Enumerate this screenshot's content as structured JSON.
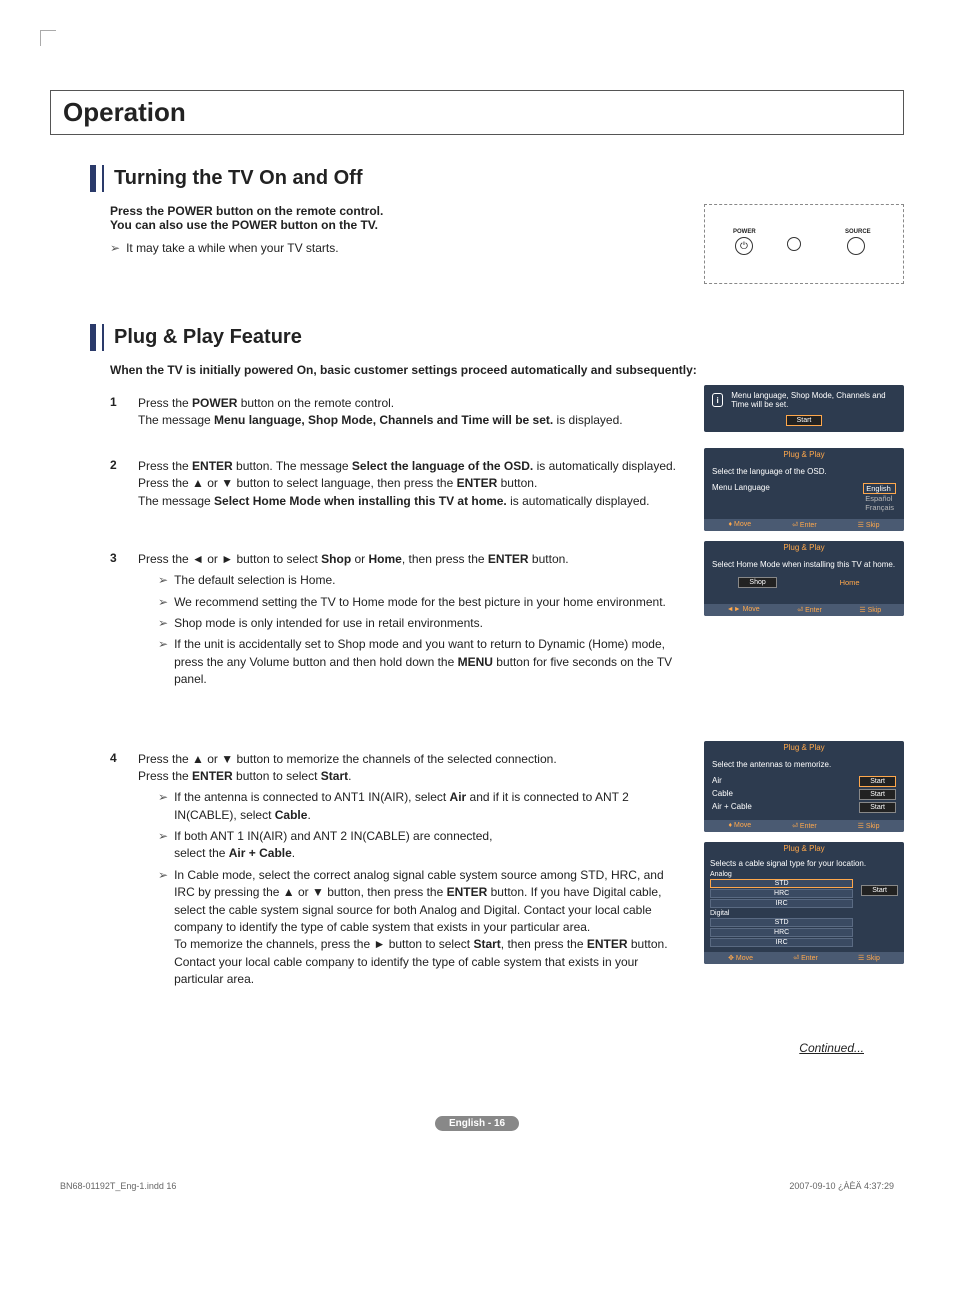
{
  "page": {
    "main_title": "Operation",
    "continued": "Continued...",
    "badge": "English - 16",
    "doc_id": "BN68-01192T_Eng-1.indd   16",
    "timestamp": "2007-09-10   ¿ÀÈÄ 4:37:29"
  },
  "section1": {
    "title": "Turning the TV On and Off",
    "intro_l1": "Press the POWER button on the remote control.",
    "intro_l2": "You can also use the POWER button on the TV.",
    "note1": "It may take a while when your TV starts.",
    "remote": {
      "power": "POWER",
      "source": "SOURCE"
    }
  },
  "section2": {
    "title": "Plug & Play Feature",
    "intro": "When the TV is initially powered On, basic customer settings proceed automatically and subsequently:",
    "step1": {
      "num": "1",
      "t1a": "Press the ",
      "t1b": "POWER",
      "t1c": " button on the remote control.",
      "t2a": "The message ",
      "t2b": "Menu language, Shop Mode, Channels and Time will be set.",
      "t2c": " is displayed."
    },
    "step2": {
      "num": "2",
      "t1a": "Press the ",
      "t1b": "ENTER",
      "t1c": " button. The message ",
      "t1d": "Select the language of the OSD.",
      "t1e": " is automatically displayed.",
      "t2a": "Press the ▲ or ▼ button to select language, then press the ",
      "t2b": "ENTER",
      "t2c": " button.",
      "t3a": "The message ",
      "t3b": "Select Home Mode when installing this TV at home.",
      "t3c": " is automatically displayed."
    },
    "step3": {
      "num": "3",
      "t1a": "Press the ◄ or ► button to select ",
      "t1b": "Shop",
      "t1c": " or ",
      "t1d": "Home",
      "t1e": ", then press the ",
      "t1f": "ENTER",
      "t1g": " button.",
      "b1": "The default selection is Home.",
      "b2": "We recommend setting the TV to Home mode for the best picture in your home environment.",
      "b3": "Shop mode is only intended for use in retail environments.",
      "b4a": "If the unit is accidentally set to Shop mode and you want to return to Dynamic (Home) mode, press the any Volume button and then hold down the ",
      "b4b": "MENU",
      "b4c": " button for five seconds on the TV panel."
    },
    "step4": {
      "num": "4",
      "t1": "Press the ▲ or ▼ button to memorize the channels of the selected connection.",
      "t2a": "Press the ",
      "t2b": "ENTER",
      "t2c": " button to select ",
      "t2d": "Start",
      "t2e": ".",
      "b1a": "If the antenna is connected to ANT1 IN(AIR), select ",
      "b1b": "Air",
      "b1c": " and if it is connected to ANT 2 IN(CABLE), select ",
      "b1d": "Cable",
      "b1e": ".",
      "b2a": "If both ANT 1 IN(AIR) and ANT 2 IN(CABLE) are connected,",
      "b2b": "select the ",
      "b2c": "Air + Cable",
      "b2d": ".",
      "b3a": "In Cable mode, select the correct analog signal cable system source among STD, HRC, and IRC by pressing the ▲ or ▼ button, then press the ",
      "b3b": "ENTER",
      "b3c": " button. If you have Digital cable, select the cable system signal source for both Analog and Digital. Contact your local cable company to identify the type of cable system that exists in your particular area.",
      "b3d": "To memorize the channels, press the ► button to select ",
      "b3e": "Start",
      "b3f": ", then press the ",
      "b3g": "ENTER",
      "b3h": " button.",
      "b3i": "Contact your local cable company to identify the type of cable system that exists in your particular area."
    }
  },
  "osd1": {
    "msg": "Menu language, Shop Mode, Channels and Time will be set.",
    "btn": "Start"
  },
  "osd2": {
    "title": "Plug & Play",
    "msg": "Select the language of the OSD.",
    "label": "Menu Language",
    "opts": [
      "English",
      "Español",
      "Français"
    ],
    "foot": {
      "move": "Move",
      "enter": "Enter",
      "skip": "Skip"
    }
  },
  "osd3": {
    "title": "Plug & Play",
    "msg": "Select Home Mode when installing this TV at home.",
    "shop": "Shop",
    "home": "Home",
    "foot": {
      "move": "Move",
      "enter": "Enter",
      "skip": "Skip"
    }
  },
  "osd4": {
    "title": "Plug & Play",
    "msg": "Select the antennas to memorize.",
    "rows": [
      {
        "label": "Air",
        "btn": "Start"
      },
      {
        "label": "Cable",
        "btn": "Start"
      },
      {
        "label": "Air + Cable",
        "btn": "Start"
      }
    ],
    "foot": {
      "move": "Move",
      "enter": "Enter",
      "skip": "Skip"
    }
  },
  "osd5": {
    "title": "Plug & Play",
    "msg": "Selects a cable signal type for your location.",
    "analog": "Analog",
    "digital": "Digital",
    "subs": [
      "STD",
      "HRC",
      "IRC"
    ],
    "btn": "Start",
    "foot": {
      "move": "Move",
      "enter": "Enter",
      "skip": "Skip"
    }
  }
}
